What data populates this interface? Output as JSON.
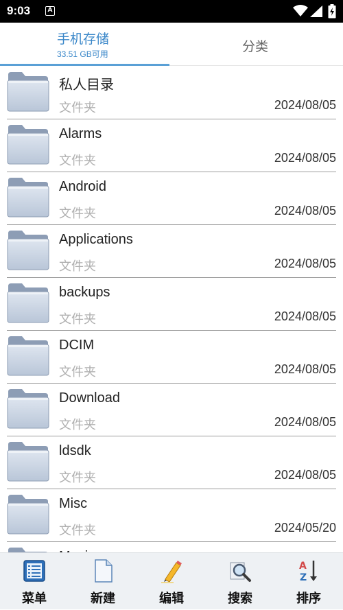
{
  "status_bar": {
    "time": "9:03",
    "notification_icon": "A"
  },
  "tabs": {
    "storage": {
      "title": "手机存储",
      "subtitle": "33.51 GB可用"
    },
    "category": {
      "title": "分类"
    }
  },
  "files": [
    {
      "name": "私人目录",
      "type": "文件夹",
      "date": "2024/08/05"
    },
    {
      "name": "Alarms",
      "type": "文件夹",
      "date": "2024/08/05"
    },
    {
      "name": "Android",
      "type": "文件夹",
      "date": "2024/08/05"
    },
    {
      "name": "Applications",
      "type": "文件夹",
      "date": "2024/08/05"
    },
    {
      "name": "backups",
      "type": "文件夹",
      "date": "2024/08/05"
    },
    {
      "name": "DCIM",
      "type": "文件夹",
      "date": "2024/08/05"
    },
    {
      "name": "Download",
      "type": "文件夹",
      "date": "2024/08/05"
    },
    {
      "name": "ldsdk",
      "type": "文件夹",
      "date": "2024/08/05"
    },
    {
      "name": "Misc",
      "type": "文件夹",
      "date": "2024/05/20"
    },
    {
      "name": "Movies",
      "type": "",
      "date": ""
    }
  ],
  "bottom_bar": {
    "menu": "菜单",
    "new": "新建",
    "edit": "编辑",
    "search": "搜索",
    "sort": "排序"
  }
}
